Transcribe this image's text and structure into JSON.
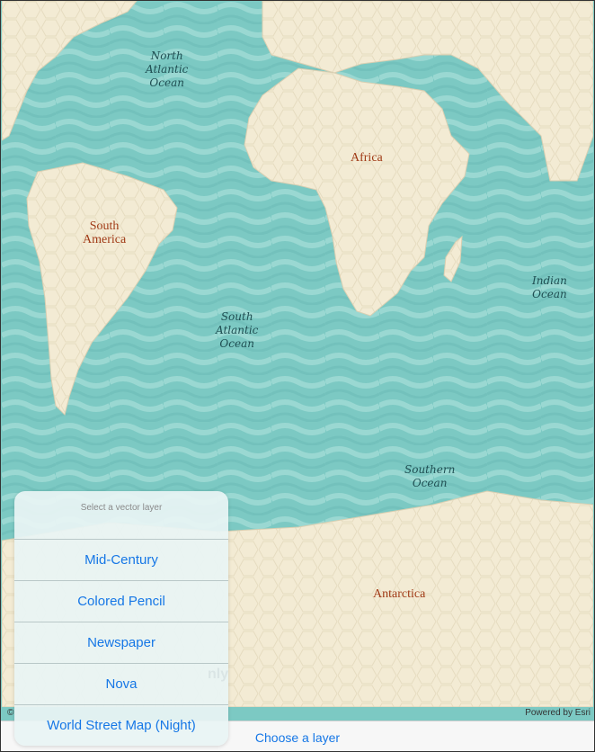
{
  "map": {
    "ocean_labels": {
      "north_atlantic": [
        "North",
        "Atlantic",
        "Ocean"
      ],
      "south_atlantic": [
        "South",
        "Atlantic",
        "Ocean"
      ],
      "indian": [
        "Indian",
        "Ocean"
      ],
      "southern": [
        "Southern",
        "Ocean"
      ]
    },
    "land_labels": {
      "africa": "Africa",
      "south_america": [
        "South",
        "America"
      ],
      "antarctica": "Antarctica"
    },
    "attribution": "Powered by Esri",
    "attribution_left": "©",
    "partial_overlay_text": "nly"
  },
  "layer_sheet": {
    "title": "Select a vector layer",
    "items": [
      "Mid-Century",
      "Colored Pencil",
      "Newspaper",
      "Nova",
      "World Street Map (Night)"
    ]
  },
  "toolbar": {
    "choose_layer": "Choose a layer"
  },
  "colors": {
    "ocean": "#7cc9c3",
    "land": "#f4ecd6",
    "accent": "#1677e6"
  }
}
